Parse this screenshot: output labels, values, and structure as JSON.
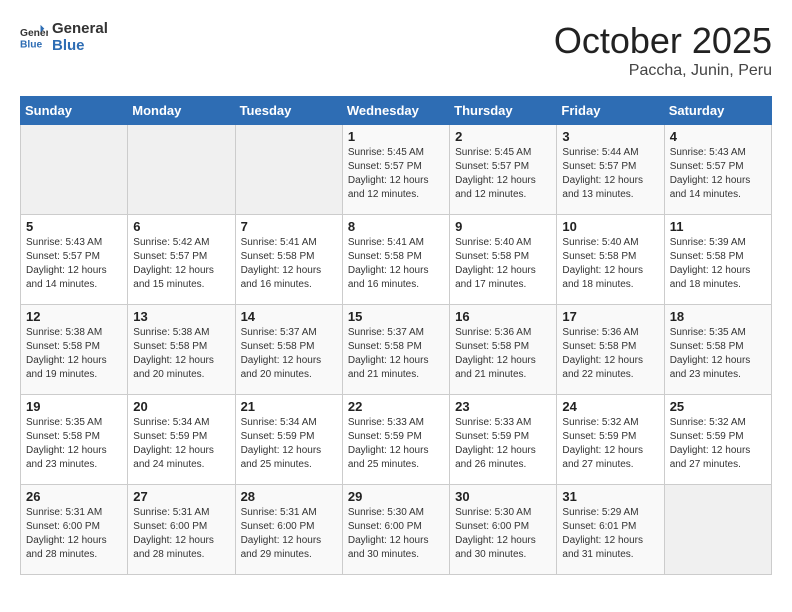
{
  "header": {
    "logo_line1": "General",
    "logo_line2": "Blue",
    "month": "October 2025",
    "location": "Paccha, Junin, Peru"
  },
  "weekdays": [
    "Sunday",
    "Monday",
    "Tuesday",
    "Wednesday",
    "Thursday",
    "Friday",
    "Saturday"
  ],
  "weeks": [
    [
      {
        "day": "",
        "info": ""
      },
      {
        "day": "",
        "info": ""
      },
      {
        "day": "",
        "info": ""
      },
      {
        "day": "1",
        "info": "Sunrise: 5:45 AM\nSunset: 5:57 PM\nDaylight: 12 hours\nand 12 minutes."
      },
      {
        "day": "2",
        "info": "Sunrise: 5:45 AM\nSunset: 5:57 PM\nDaylight: 12 hours\nand 12 minutes."
      },
      {
        "day": "3",
        "info": "Sunrise: 5:44 AM\nSunset: 5:57 PM\nDaylight: 12 hours\nand 13 minutes."
      },
      {
        "day": "4",
        "info": "Sunrise: 5:43 AM\nSunset: 5:57 PM\nDaylight: 12 hours\nand 14 minutes."
      }
    ],
    [
      {
        "day": "5",
        "info": "Sunrise: 5:43 AM\nSunset: 5:57 PM\nDaylight: 12 hours\nand 14 minutes."
      },
      {
        "day": "6",
        "info": "Sunrise: 5:42 AM\nSunset: 5:57 PM\nDaylight: 12 hours\nand 15 minutes."
      },
      {
        "day": "7",
        "info": "Sunrise: 5:41 AM\nSunset: 5:58 PM\nDaylight: 12 hours\nand 16 minutes."
      },
      {
        "day": "8",
        "info": "Sunrise: 5:41 AM\nSunset: 5:58 PM\nDaylight: 12 hours\nand 16 minutes."
      },
      {
        "day": "9",
        "info": "Sunrise: 5:40 AM\nSunset: 5:58 PM\nDaylight: 12 hours\nand 17 minutes."
      },
      {
        "day": "10",
        "info": "Sunrise: 5:40 AM\nSunset: 5:58 PM\nDaylight: 12 hours\nand 18 minutes."
      },
      {
        "day": "11",
        "info": "Sunrise: 5:39 AM\nSunset: 5:58 PM\nDaylight: 12 hours\nand 18 minutes."
      }
    ],
    [
      {
        "day": "12",
        "info": "Sunrise: 5:38 AM\nSunset: 5:58 PM\nDaylight: 12 hours\nand 19 minutes."
      },
      {
        "day": "13",
        "info": "Sunrise: 5:38 AM\nSunset: 5:58 PM\nDaylight: 12 hours\nand 20 minutes."
      },
      {
        "day": "14",
        "info": "Sunrise: 5:37 AM\nSunset: 5:58 PM\nDaylight: 12 hours\nand 20 minutes."
      },
      {
        "day": "15",
        "info": "Sunrise: 5:37 AM\nSunset: 5:58 PM\nDaylight: 12 hours\nand 21 minutes."
      },
      {
        "day": "16",
        "info": "Sunrise: 5:36 AM\nSunset: 5:58 PM\nDaylight: 12 hours\nand 21 minutes."
      },
      {
        "day": "17",
        "info": "Sunrise: 5:36 AM\nSunset: 5:58 PM\nDaylight: 12 hours\nand 22 minutes."
      },
      {
        "day": "18",
        "info": "Sunrise: 5:35 AM\nSunset: 5:58 PM\nDaylight: 12 hours\nand 23 minutes."
      }
    ],
    [
      {
        "day": "19",
        "info": "Sunrise: 5:35 AM\nSunset: 5:58 PM\nDaylight: 12 hours\nand 23 minutes."
      },
      {
        "day": "20",
        "info": "Sunrise: 5:34 AM\nSunset: 5:59 PM\nDaylight: 12 hours\nand 24 minutes."
      },
      {
        "day": "21",
        "info": "Sunrise: 5:34 AM\nSunset: 5:59 PM\nDaylight: 12 hours\nand 25 minutes."
      },
      {
        "day": "22",
        "info": "Sunrise: 5:33 AM\nSunset: 5:59 PM\nDaylight: 12 hours\nand 25 minutes."
      },
      {
        "day": "23",
        "info": "Sunrise: 5:33 AM\nSunset: 5:59 PM\nDaylight: 12 hours\nand 26 minutes."
      },
      {
        "day": "24",
        "info": "Sunrise: 5:32 AM\nSunset: 5:59 PM\nDaylight: 12 hours\nand 27 minutes."
      },
      {
        "day": "25",
        "info": "Sunrise: 5:32 AM\nSunset: 5:59 PM\nDaylight: 12 hours\nand 27 minutes."
      }
    ],
    [
      {
        "day": "26",
        "info": "Sunrise: 5:31 AM\nSunset: 6:00 PM\nDaylight: 12 hours\nand 28 minutes."
      },
      {
        "day": "27",
        "info": "Sunrise: 5:31 AM\nSunset: 6:00 PM\nDaylight: 12 hours\nand 28 minutes."
      },
      {
        "day": "28",
        "info": "Sunrise: 5:31 AM\nSunset: 6:00 PM\nDaylight: 12 hours\nand 29 minutes."
      },
      {
        "day": "29",
        "info": "Sunrise: 5:30 AM\nSunset: 6:00 PM\nDaylight: 12 hours\nand 30 minutes."
      },
      {
        "day": "30",
        "info": "Sunrise: 5:30 AM\nSunset: 6:00 PM\nDaylight: 12 hours\nand 30 minutes."
      },
      {
        "day": "31",
        "info": "Sunrise: 5:29 AM\nSunset: 6:01 PM\nDaylight: 12 hours\nand 31 minutes."
      },
      {
        "day": "",
        "info": ""
      }
    ]
  ]
}
